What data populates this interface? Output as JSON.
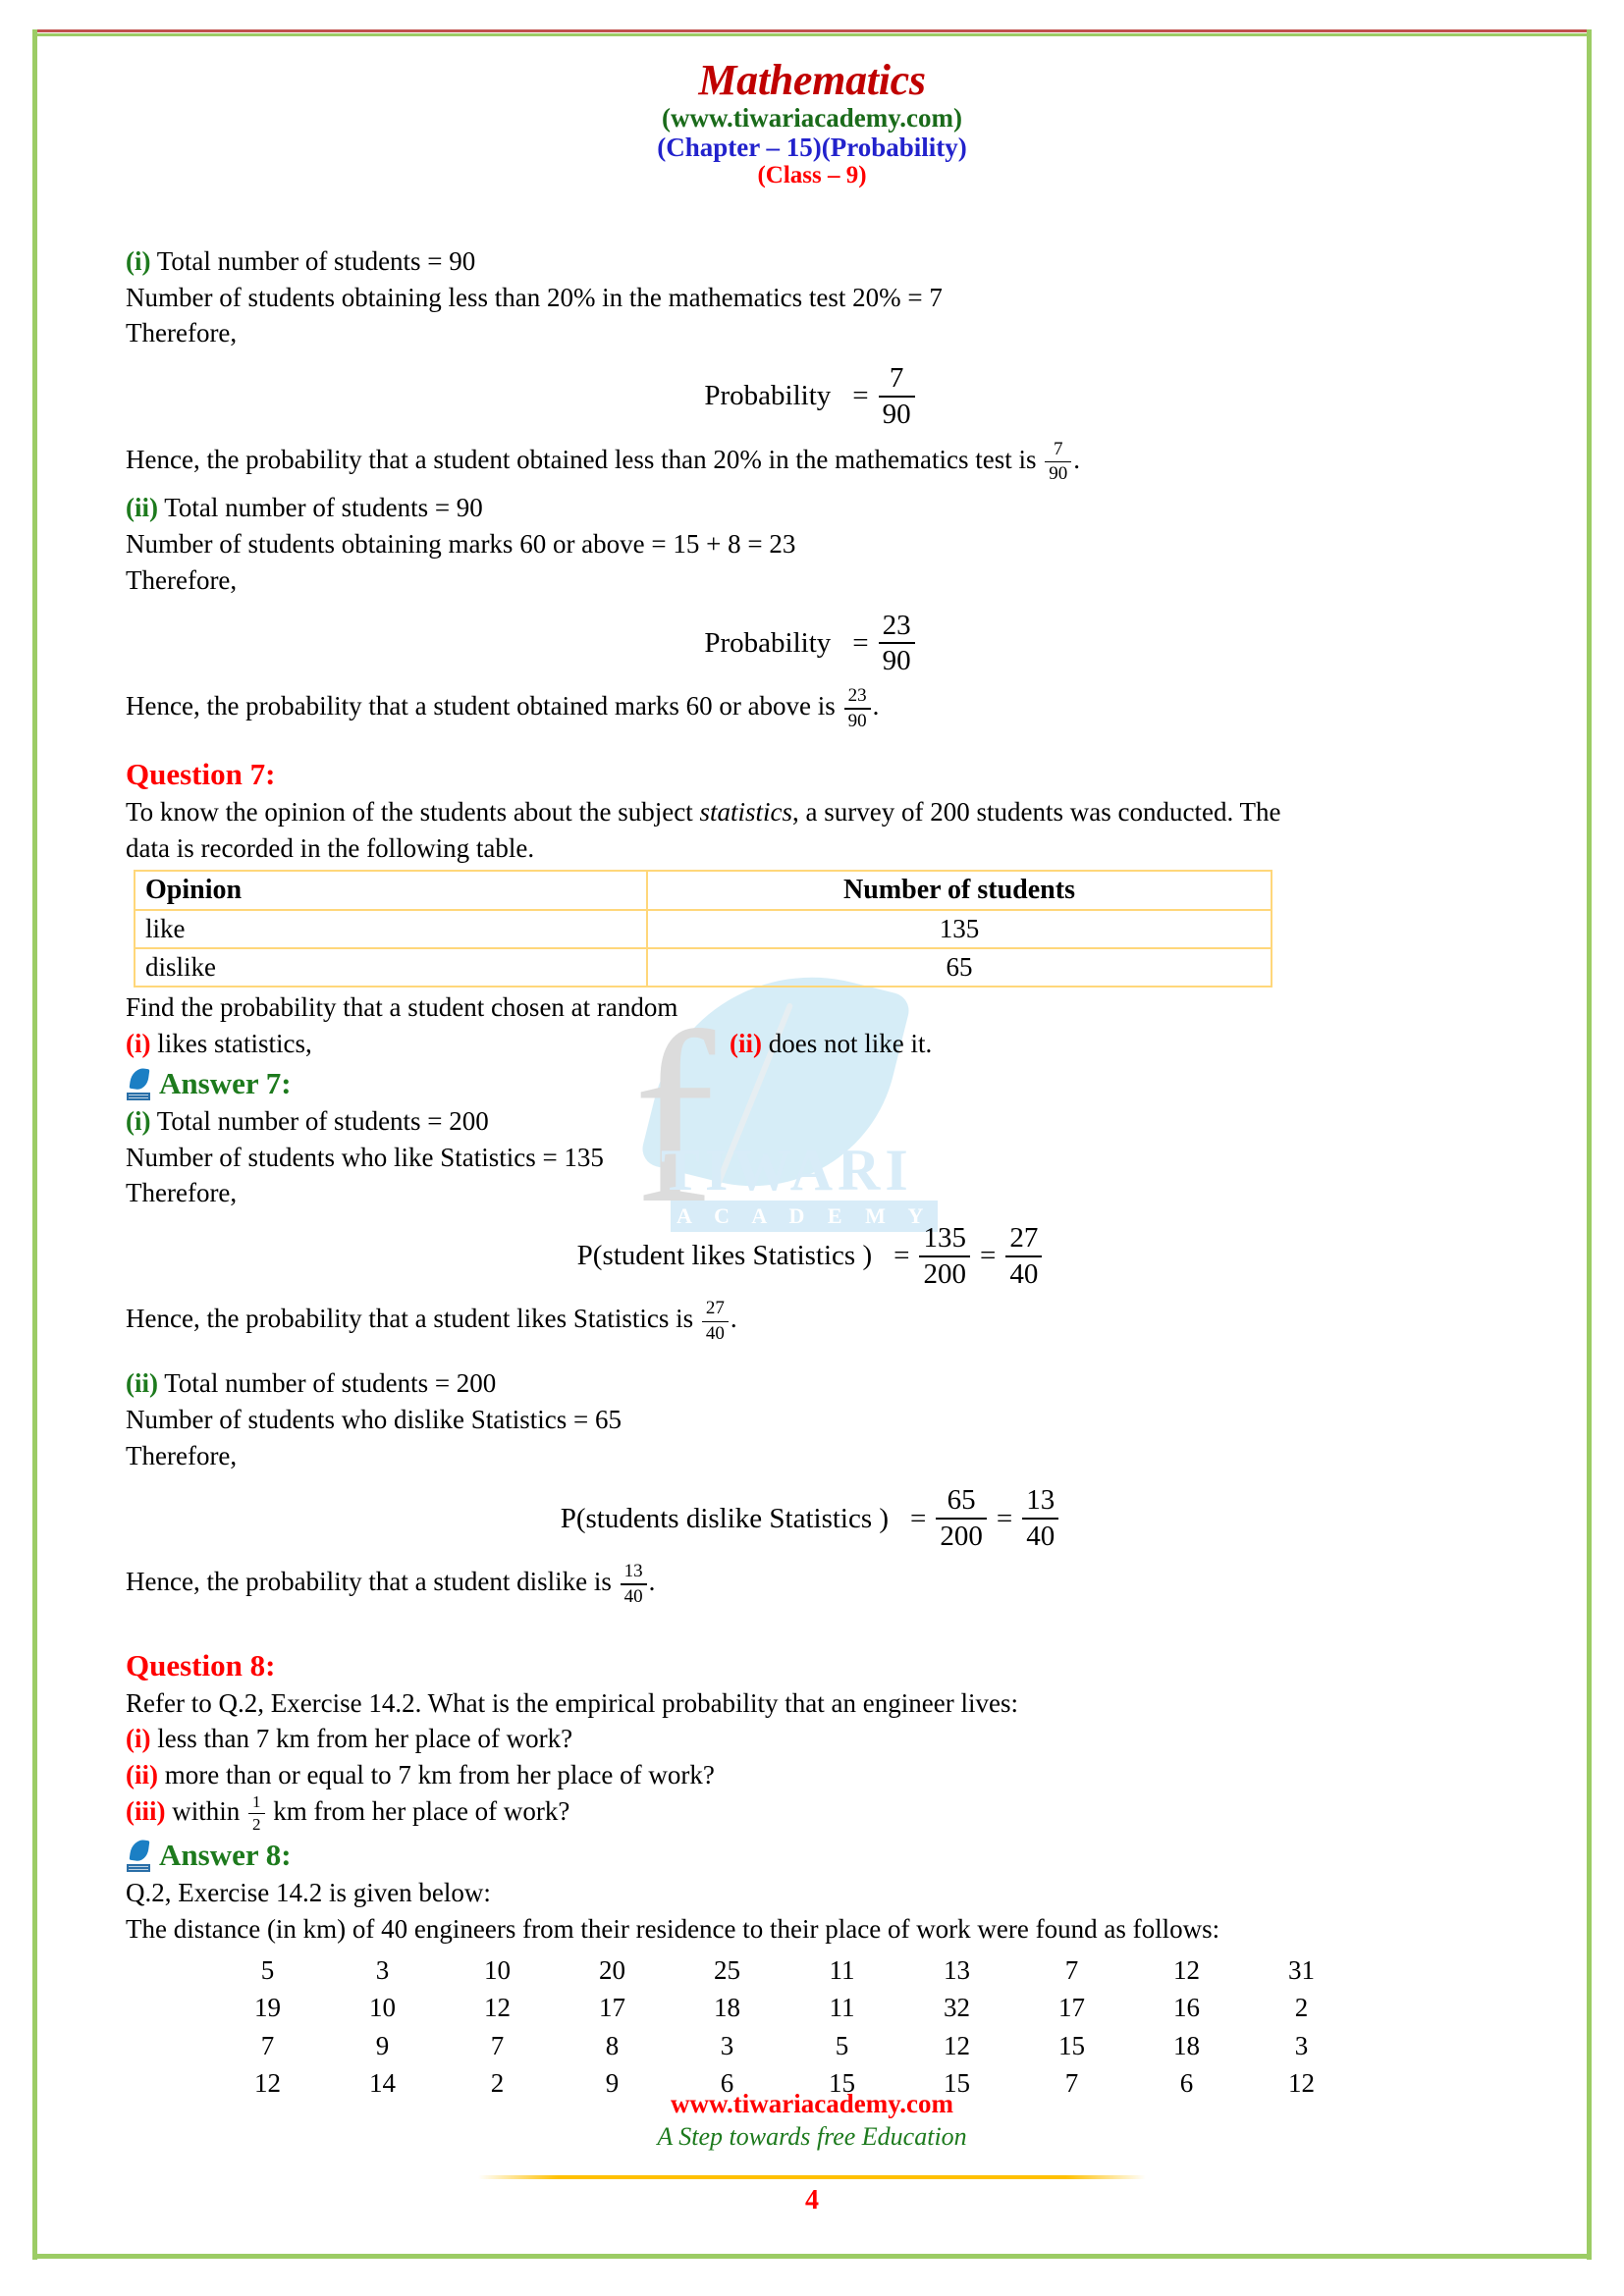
{
  "header": {
    "title": "Mathematics",
    "site": "(www.tiwariacademy.com)",
    "chapter": "(Chapter – 15)(Probability)",
    "class": "(Class – 9)"
  },
  "answer6": {
    "part_i": {
      "roman": "(i)",
      "l1": " Total number of students = 90",
      "l2": "Number of students obtaining less than 20% in the mathematics test 20% = 7",
      "l3": "Therefore,",
      "eq_label": "Probability",
      "eq_equals": "=",
      "frac_num": "7",
      "frac_den": "90",
      "hence_pre": "Hence, the probability that a student obtained less than 20% in the mathematics test is ",
      "hence_num": "7",
      "hence_den": "90",
      "hence_post": "."
    },
    "part_ii": {
      "roman": "(ii)",
      "l1": " Total number of students = 90",
      "l2": "Number of students obtaining marks 60 or above = 15 + 8 = 23",
      "l3": "Therefore,",
      "eq_label": "Probability",
      "eq_equals": "=",
      "frac_num": "23",
      "frac_den": "90",
      "hence_pre": "Hence, the probability that a student obtained marks 60 or above is ",
      "hence_num": "23",
      "hence_den": "90",
      "hence_post": "."
    }
  },
  "question7": {
    "heading": "Question 7:",
    "body_line1_a": "To know the opinion of the students about the subject ",
    "body_line1_italic": "statistics",
    "body_line1_b": ", a survey of 200 students was conducted. The",
    "body_line2": "data is recorded in the following table.",
    "table": {
      "headers": [
        "Opinion",
        "Number of students"
      ],
      "rows": [
        [
          "like",
          "135"
        ],
        [
          "dislike",
          "65"
        ]
      ]
    },
    "find": "Find the probability that a student chosen at random",
    "opt_i_roman": "(i)",
    "opt_i_text": " likes statistics,",
    "opt_ii_roman": "(ii)",
    "opt_ii_text": " does not like it."
  },
  "answer7": {
    "heading": "Answer 7:",
    "icon": "leaf-feather-icon",
    "part_i": {
      "roman": "(i)",
      "l1": " Total number of students = 200",
      "l2": "Number of students who like Statistics = 135",
      "l3": "Therefore,",
      "eq_label": "P(student likes Statistics )",
      "eq_equals": "=",
      "f1_num": "135",
      "f1_den": "200",
      "eq_equals2": "=",
      "f2_num": "27",
      "f2_den": "40",
      "hence_pre": "Hence, the probability that a student likes Statistics is ",
      "hence_num": "27",
      "hence_den": "40",
      "hence_post": "."
    },
    "part_ii": {
      "roman": "(ii)",
      "l1": " Total number of students = 200",
      "l2": "Number of students who dislike Statistics = 65",
      "l3": "Therefore,",
      "eq_label": "P(students dislike Statistics )",
      "eq_equals": "=",
      "f1_num": "65",
      "f1_den": "200",
      "eq_equals2": "=",
      "f2_num": "13",
      "f2_den": "40",
      "hence_pre": "Hence, the probability that a student dislike is ",
      "hence_num": "13",
      "hence_den": "40",
      "hence_post": "."
    }
  },
  "question8": {
    "heading": "Question 8:",
    "body": "Refer to Q.2, Exercise 14.2. What is the empirical probability that an engineer lives:",
    "opt_i_roman": "(i)",
    "opt_i_text": " less than 7 km from her place of work?",
    "opt_ii_roman": "(ii)",
    "opt_ii_text": " more than or equal to 7 km from her place of work?",
    "opt_iii_roman": "(iii)",
    "opt_iii_pre": " within ",
    "opt_iii_num": "1",
    "opt_iii_den": "2",
    "opt_iii_post": " km from her place of work?"
  },
  "answer8": {
    "heading": "Answer 8:",
    "icon": "leaf-feather-icon",
    "l1": "Q.2, Exercise 14.2 is given below:",
    "l2": "The distance (in km) of 40 engineers from their residence to their place of work were found as follows:",
    "data_grid": [
      [
        "5",
        "3",
        "10",
        "20",
        "25",
        "11",
        "13",
        "7",
        "12",
        "31"
      ],
      [
        "19",
        "10",
        "12",
        "17",
        "18",
        "11",
        "32",
        "17",
        "16",
        "2"
      ],
      [
        "7",
        "9",
        "7",
        "8",
        "3",
        "5",
        "12",
        "15",
        "18",
        "3"
      ],
      [
        "12",
        "14",
        "2",
        "9",
        "6",
        "15",
        "15",
        "7",
        "6",
        "12"
      ]
    ]
  },
  "watermark": {
    "brand": "TIWARI",
    "sub": "A C A D E M Y"
  },
  "footer": {
    "url": "www.tiwariacademy.com",
    "tagline": "A Step towards free Education",
    "page": "4"
  },
  "colors": {
    "title_red": "#c00000",
    "site_green": "#1a6b1a",
    "chapter_blue": "#2222cc",
    "class_red": "#ff0000",
    "question_red": "#ff0000",
    "answer_green": "#1d7a1d",
    "border_green": "#9ccc65",
    "table_border": "#ffd77a",
    "rule_orange": "#ffc000"
  }
}
